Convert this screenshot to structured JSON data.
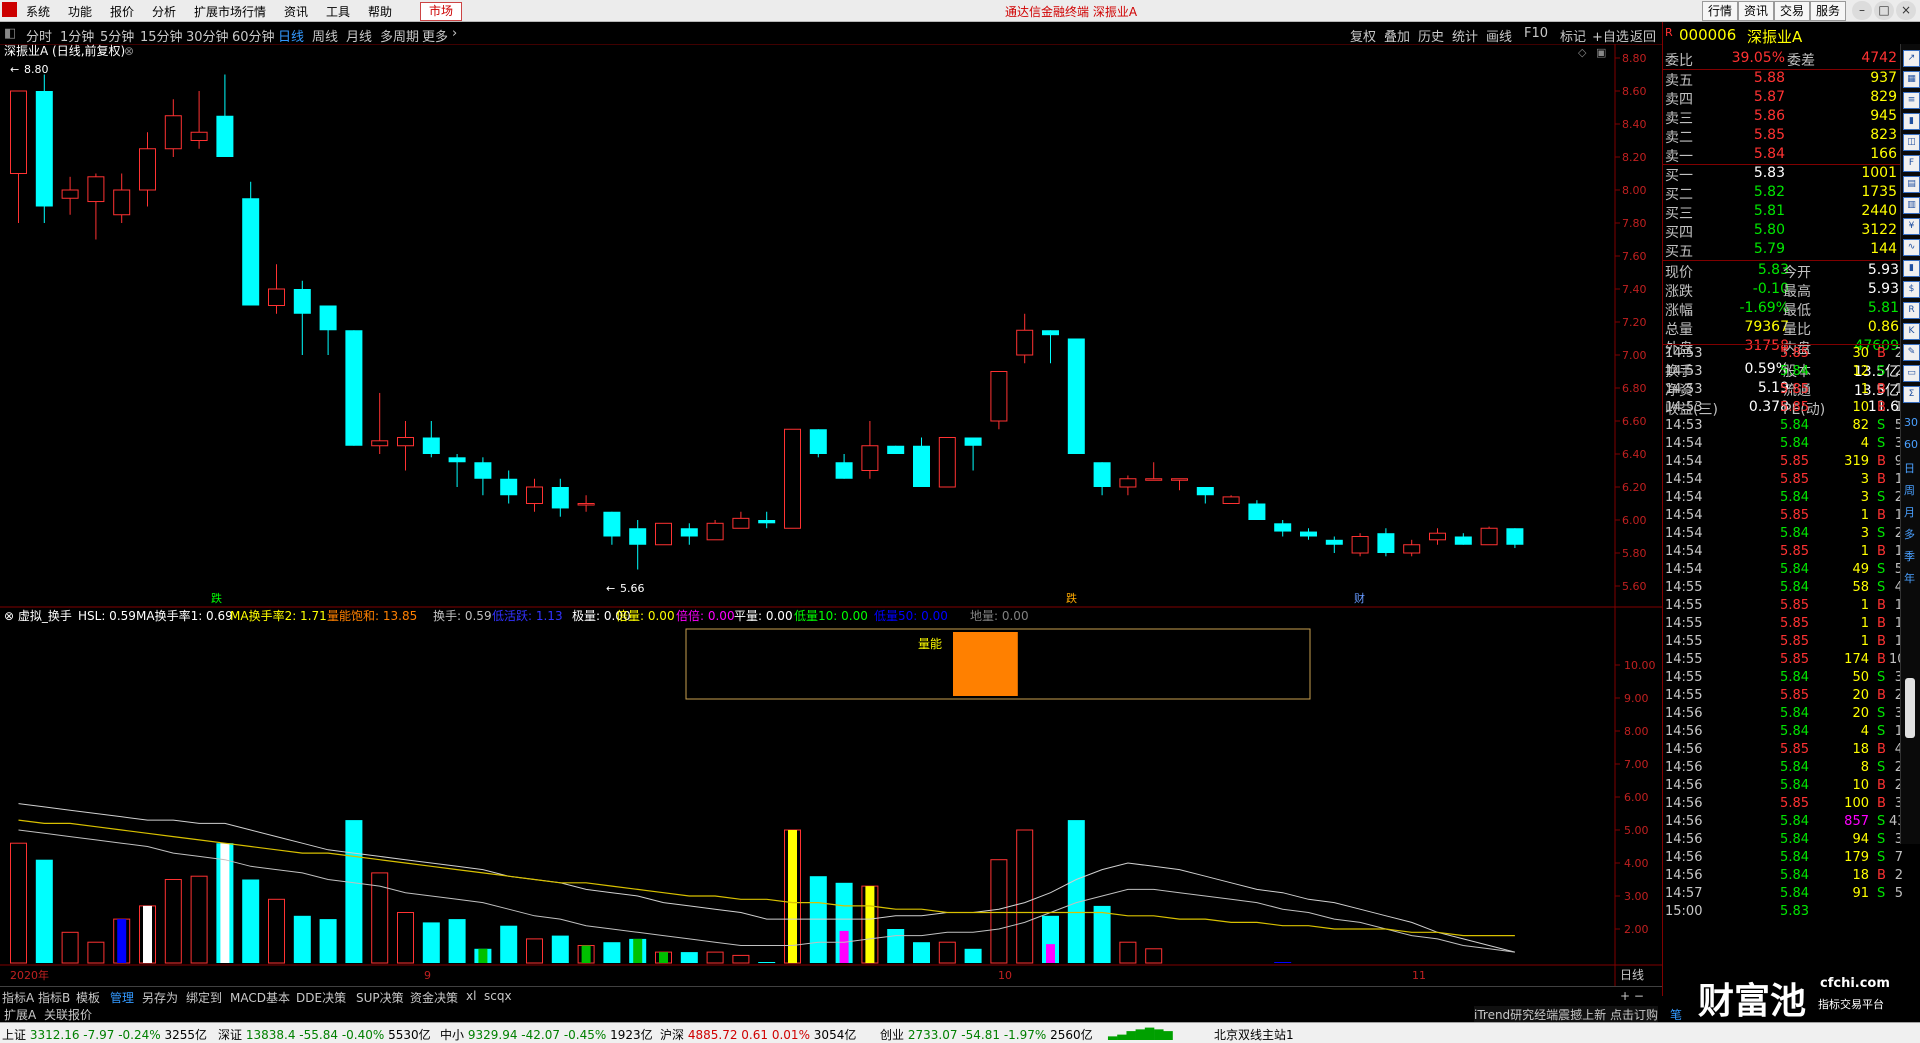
{
  "menu": {
    "items": [
      "系统",
      "功能",
      "报价",
      "分析",
      "扩展市场行情",
      "资讯",
      "工具",
      "帮助"
    ],
    "market_btn": "市场",
    "window_title": "通达信金融终端 深振业A",
    "right_buttons": [
      "行情",
      "资讯",
      "交易",
      "服务"
    ]
  },
  "periods": {
    "items": [
      "分时",
      "1分钟",
      "5分钟",
      "15分钟",
      "30分钟",
      "60分钟",
      "日线",
      "周线",
      "月线",
      "多周期",
      "更多"
    ],
    "active_index": 6,
    "tools": [
      "复权",
      "叠加",
      "历史",
      "统计",
      "画线",
      "F10",
      "标记",
      "+自选",
      "返回"
    ]
  },
  "stock": {
    "title": "深振业A (日线,前复权)",
    "code": "000006",
    "name": "深振业A",
    "high_label": "8.80",
    "low_label": "5.66",
    "markers": [
      "跌",
      "跌",
      "财"
    ]
  },
  "main_axis": {
    "ticks": [
      "8.80",
      "8.60",
      "8.40",
      "8.20",
      "8.00",
      "7.80",
      "7.60",
      "7.40",
      "7.20",
      "7.00",
      "6.80",
      "6.60",
      "6.40",
      "6.20",
      "6.00",
      "5.80",
      "5.60"
    ]
  },
  "indicator": {
    "name": "虚拟_换手",
    "items": [
      {
        "label": "HSL: 0.59",
        "color": "#ffffff"
      },
      {
        "label": "MA换手率1: 0.69",
        "color": "#ffffff"
      },
      {
        "label": "MA换手率2: 1.71",
        "color": "#ffff00"
      },
      {
        "label": "量能饱和: 13.85",
        "color": "#ff8000"
      },
      {
        "label": "换手: 0.59",
        "color": "#c0c0c0"
      },
      {
        "label": "低活跃: 1.13",
        "color": "#3232ff"
      },
      {
        "label": "极量: 0.00",
        "color": "#ffffff"
      },
      {
        "label": "倍量: 0.00",
        "color": "#ffff00"
      },
      {
        "label": "倍倍: 0.00",
        "color": "#ff00ff"
      },
      {
        "label": "平量: 0.00",
        "color": "#ffffff"
      },
      {
        "label": "低量10: 0.00",
        "color": "#00ff00"
      },
      {
        "label": "低量50: 0.00",
        "color": "#0000ff"
      },
      {
        "label": "地量: 0.00",
        "color": "#808080"
      }
    ],
    "box_label": "量能",
    "saturation_pct": 13.85,
    "axis_ticks": [
      "10.00",
      "9.00",
      "8.00",
      "7.00",
      "6.00",
      "5.00",
      "4.00",
      "3.00",
      "2.00"
    ],
    "date_labels": [
      "2020年",
      "9",
      "10",
      "11"
    ],
    "period_label": "日线"
  },
  "chart_data": {
    "type": "candlestick",
    "y_range": [
      5.6,
      8.8
    ],
    "candles": [
      [
        8.1,
        8.6,
        8.3,
        7.8
      ],
      [
        8.6,
        7.9,
        8.7,
        7.8
      ],
      [
        7.95,
        8.0,
        8.08,
        7.85
      ],
      [
        7.93,
        8.08,
        8.1,
        7.7
      ],
      [
        7.85,
        8.0,
        8.1,
        7.8
      ],
      [
        8.0,
        8.25,
        8.35,
        7.9
      ],
      [
        8.25,
        8.45,
        8.55,
        8.2
      ],
      [
        8.3,
        8.35,
        8.6,
        8.25
      ],
      [
        8.45,
        8.2,
        8.7,
        8.2
      ],
      [
        7.95,
        7.3,
        8.05,
        7.3
      ],
      [
        7.3,
        7.4,
        7.55,
        7.25
      ],
      [
        7.4,
        7.25,
        7.45,
        7.0
      ],
      [
        7.3,
        7.15,
        7.3,
        7.0
      ],
      [
        7.15,
        6.45,
        7.15,
        6.45
      ],
      [
        6.45,
        6.48,
        6.77,
        6.4
      ],
      [
        6.45,
        6.5,
        6.6,
        6.3
      ],
      [
        6.5,
        6.4,
        6.6,
        6.38
      ],
      [
        6.38,
        6.35,
        6.4,
        6.2
      ],
      [
        6.35,
        6.25,
        6.38,
        6.15
      ],
      [
        6.25,
        6.15,
        6.3,
        6.1
      ],
      [
        6.1,
        6.2,
        6.25,
        6.05
      ],
      [
        6.2,
        6.07,
        6.25,
        6.02
      ],
      [
        6.1,
        6.1,
        6.15,
        6.05
      ],
      [
        6.05,
        5.9,
        6.05,
        5.85
      ],
      [
        5.95,
        5.85,
        6.0,
        5.7
      ],
      [
        5.85,
        5.98,
        5.98,
        5.85
      ],
      [
        5.95,
        5.9,
        5.98,
        5.85
      ],
      [
        5.88,
        5.98,
        6.0,
        5.88
      ],
      [
        5.95,
        6.01,
        6.05,
        5.95
      ],
      [
        6.0,
        5.98,
        6.05,
        5.95
      ],
      [
        5.95,
        6.55,
        6.55,
        5.95
      ],
      [
        6.55,
        6.4,
        6.55,
        6.38
      ],
      [
        6.35,
        6.25,
        6.4,
        6.25
      ],
      [
        6.3,
        6.45,
        6.6,
        6.25
      ],
      [
        6.45,
        6.4,
        6.45,
        6.4
      ],
      [
        6.45,
        6.2,
        6.5,
        6.2
      ],
      [
        6.2,
        6.5,
        6.5,
        6.2
      ],
      [
        6.5,
        6.45,
        6.5,
        6.3
      ],
      [
        6.6,
        6.9,
        6.9,
        6.55
      ],
      [
        7.0,
        7.15,
        7.25,
        6.95
      ],
      [
        7.15,
        7.12,
        7.15,
        6.95
      ],
      [
        7.1,
        6.4,
        7.1,
        6.4
      ],
      [
        6.35,
        6.2,
        6.35,
        6.15
      ],
      [
        6.2,
        6.25,
        6.27,
        6.15
      ],
      [
        6.25,
        6.25,
        6.35,
        6.25
      ],
      [
        6.25,
        6.25,
        6.25,
        6.18
      ],
      [
        6.2,
        6.15,
        6.2,
        6.1
      ],
      [
        6.1,
        6.14,
        6.15,
        6.1
      ],
      [
        6.1,
        6.0,
        6.12,
        6.0
      ],
      [
        5.98,
        5.93,
        6.0,
        5.9
      ],
      [
        5.93,
        5.9,
        5.95,
        5.88
      ],
      [
        5.88,
        5.85,
        5.9,
        5.8
      ],
      [
        5.8,
        5.9,
        5.92,
        5.78
      ],
      [
        5.92,
        5.8,
        5.95,
        5.78
      ],
      [
        5.8,
        5.85,
        5.88,
        5.78
      ],
      [
        5.88,
        5.92,
        5.95,
        5.85
      ],
      [
        5.9,
        5.85,
        5.92,
        5.85
      ],
      [
        5.85,
        5.95,
        5.96,
        5.85
      ],
      [
        5.95,
        5.85,
        5.95,
        5.83
      ]
    ],
    "turnover": [
      4.6,
      4.1,
      1.9,
      1.6,
      2.3,
      2.7,
      3.5,
      3.6,
      4.6,
      3.5,
      2.9,
      2.4,
      2.3,
      5.3,
      3.7,
      2.5,
      2.2,
      2.3,
      1.4,
      2.1,
      1.7,
      1.8,
      1.5,
      1.6,
      1.7,
      1.3,
      1.3,
      1.3,
      1.2,
      1.0,
      5.0,
      3.6,
      3.4,
      3.3,
      2.0,
      1.6,
      1.6,
      1.4,
      4.1,
      5.0,
      2.4,
      5.3,
      2.7,
      1.6,
      1.4,
      0.9,
      0.8,
      0.8,
      0.9,
      1.0,
      0.9,
      0.8,
      0.8,
      0.9,
      0.8,
      0.7,
      0.6,
      0.9,
      0.6
    ],
    "ma1": [
      5.8,
      5.7,
      5.6,
      5.5,
      5.4,
      5.3,
      5.3,
      5.2,
      5.2,
      5.0,
      4.8,
      4.6,
      4.4,
      4.3,
      4.2,
      4.1,
      4.0,
      3.9,
      3.8,
      3.6,
      3.5,
      3.4,
      3.2,
      3.1,
      3.0,
      2.8,
      2.7,
      2.6,
      2.5,
      2.3,
      2.3,
      2.3,
      2.3,
      2.3,
      2.4,
      2.4,
      2.5,
      2.5,
      2.6,
      2.8,
      3.1,
      3.5,
      3.8,
      4.0,
      3.9,
      3.8,
      3.6,
      3.4,
      3.2,
      3.1,
      2.9,
      2.8,
      2.6,
      2.4,
      2.2,
      1.9,
      1.7,
      1.5,
      1.3
    ],
    "ma2": [
      5.0,
      4.9,
      4.8,
      4.7,
      4.6,
      4.5,
      4.3,
      4.2,
      4.1,
      3.9,
      3.8,
      3.7,
      3.5,
      3.4,
      3.3,
      3.1,
      3.0,
      2.9,
      2.8,
      2.6,
      2.4,
      2.3,
      2.1,
      2.0,
      1.9,
      1.8,
      1.7,
      1.6,
      1.5,
      1.5,
      1.5,
      1.6,
      1.6,
      1.7,
      1.8,
      1.8,
      1.9,
      1.9,
      2.0,
      2.2,
      2.5,
      2.8,
      3.0,
      3.2,
      3.2,
      3.1,
      3.0,
      2.9,
      2.8,
      2.6,
      2.5,
      2.3,
      2.2,
      2.0,
      1.8,
      1.7,
      1.5,
      1.4,
      1.3
    ],
    "ma3": [
      5.3,
      5.2,
      5.2,
      5.1,
      5.0,
      4.9,
      4.8,
      4.7,
      4.6,
      4.5,
      4.4,
      4.3,
      4.3,
      4.2,
      4.1,
      4.0,
      3.9,
      3.8,
      3.7,
      3.6,
      3.5,
      3.4,
      3.4,
      3.3,
      3.2,
      3.1,
      3.0,
      3.0,
      2.9,
      2.9,
      2.8,
      2.8,
      2.7,
      2.7,
      2.6,
      2.6,
      2.5,
      2.5,
      2.5,
      2.5,
      2.5,
      2.5,
      2.5,
      2.4,
      2.4,
      2.3,
      2.3,
      2.2,
      2.2,
      2.1,
      2.1,
      2.0,
      2.0,
      2.0,
      1.9,
      1.9,
      1.8,
      1.8,
      1.8
    ]
  },
  "quote": {
    "weibi_label": "委比",
    "weibi": "39.05%",
    "weicha_label": "委差",
    "weicha": "4742",
    "asks": [
      {
        "label": "卖五",
        "price": "5.88",
        "vol": "937"
      },
      {
        "label": "卖四",
        "price": "5.87",
        "vol": "829"
      },
      {
        "label": "卖三",
        "price": "5.86",
        "vol": "945"
      },
      {
        "label": "卖二",
        "price": "5.85",
        "vol": "823"
      },
      {
        "label": "卖一",
        "price": "5.84",
        "vol": "166"
      }
    ],
    "bids": [
      {
        "label": "买一",
        "price": "5.83",
        "vol": "1001"
      },
      {
        "label": "买二",
        "price": "5.82",
        "vol": "1735"
      },
      {
        "label": "买三",
        "price": "5.81",
        "vol": "2440"
      },
      {
        "label": "买四",
        "price": "5.80",
        "vol": "3122"
      },
      {
        "label": "买五",
        "price": "5.79",
        "vol": "144"
      }
    ],
    "fields": [
      {
        "l1": "现价",
        "v1": "5.83",
        "c1": "grn",
        "l2": "今开",
        "v2": "5.93",
        "c2": "wht"
      },
      {
        "l1": "涨跌",
        "v1": "-0.10",
        "c1": "grn",
        "l2": "最高",
        "v2": "5.93",
        "c2": "wht"
      },
      {
        "l1": "涨幅",
        "v1": "-1.69%",
        "c1": "grn",
        "l2": "最低",
        "v2": "5.81",
        "c2": "grn"
      },
      {
        "l1": "总量",
        "v1": "79367",
        "c1": "yel",
        "l2": "量比",
        "v2": "0.86",
        "c2": "yel"
      },
      {
        "l1": "外盘",
        "v1": "31758",
        "c1": "red",
        "l2": "内盘",
        "v2": "47609",
        "c2": "grn"
      },
      {
        "l1": "换手",
        "v1": "0.59%",
        "c1": "wht",
        "l2": "股本",
        "v2": "13.5亿",
        "c2": "wht"
      },
      {
        "l1": "净资",
        "v1": "5.19",
        "c1": "wht",
        "l2": "流通",
        "v2": "13.5亿",
        "c2": "wht"
      },
      {
        "l1": "收益(三)",
        "v1": "0.378",
        "c1": "wht",
        "l2": "PE(动)",
        "v2": "11.6",
        "c2": "wht"
      }
    ]
  },
  "ticks": [
    {
      "t": "14:53",
      "p": "5.85",
      "v": "30",
      "s": "B",
      "n": "2"
    },
    {
      "t": "14:53",
      "p": "5.84",
      "v": "12",
      "s": "S",
      "n": "2"
    },
    {
      "t": "14:53",
      "p": "5.85",
      "v": "1",
      "s": "B",
      "n": "1"
    },
    {
      "t": "14:53",
      "p": "5.85",
      "v": "10",
      "s": "B",
      "n": "1"
    },
    {
      "t": "14:53",
      "p": "5.84",
      "v": "82",
      "s": "S",
      "n": "5"
    },
    {
      "t": "14:54",
      "p": "5.84",
      "v": "4",
      "s": "S",
      "n": "3"
    },
    {
      "t": "14:54",
      "p": "5.85",
      "v": "319",
      "s": "B",
      "n": "9"
    },
    {
      "t": "14:54",
      "p": "5.85",
      "v": "3",
      "s": "B",
      "n": "1"
    },
    {
      "t": "14:54",
      "p": "5.84",
      "v": "3",
      "s": "S",
      "n": "2"
    },
    {
      "t": "14:54",
      "p": "5.85",
      "v": "1",
      "s": "B",
      "n": "1"
    },
    {
      "t": "14:54",
      "p": "5.84",
      "v": "3",
      "s": "S",
      "n": "2"
    },
    {
      "t": "14:54",
      "p": "5.85",
      "v": "1",
      "s": "B",
      "n": "1"
    },
    {
      "t": "14:54",
      "p": "5.84",
      "v": "49",
      "s": "S",
      "n": "5"
    },
    {
      "t": "14:55",
      "p": "5.84",
      "v": "58",
      "s": "S",
      "n": "4"
    },
    {
      "t": "14:55",
      "p": "5.85",
      "v": "1",
      "s": "B",
      "n": "1"
    },
    {
      "t": "14:55",
      "p": "5.85",
      "v": "1",
      "s": "B",
      "n": "1"
    },
    {
      "t": "14:55",
      "p": "5.85",
      "v": "1",
      "s": "B",
      "n": "1"
    },
    {
      "t": "14:55",
      "p": "5.85",
      "v": "174",
      "s": "B",
      "n": "10"
    },
    {
      "t": "14:55",
      "p": "5.84",
      "v": "50",
      "s": "S",
      "n": "3"
    },
    {
      "t": "14:55",
      "p": "5.85",
      "v": "20",
      "s": "B",
      "n": "2"
    },
    {
      "t": "14:56",
      "p": "5.84",
      "v": "20",
      "s": "S",
      "n": "3"
    },
    {
      "t": "14:56",
      "p": "5.84",
      "v": "4",
      "s": "S",
      "n": "1"
    },
    {
      "t": "14:56",
      "p": "5.85",
      "v": "18",
      "s": "B",
      "n": "4"
    },
    {
      "t": "14:56",
      "p": "5.84",
      "v": "8",
      "s": "S",
      "n": "2"
    },
    {
      "t": "14:56",
      "p": "5.84",
      "v": "10",
      "s": "B",
      "n": "2"
    },
    {
      "t": "14:56",
      "p": "5.85",
      "v": "100",
      "s": "B",
      "n": "3"
    },
    {
      "t": "14:56",
      "p": "5.84",
      "v": "857",
      "s": "S",
      "n": "43"
    },
    {
      "t": "14:56",
      "p": "5.84",
      "v": "94",
      "s": "S",
      "n": "3"
    },
    {
      "t": "14:56",
      "p": "5.84",
      "v": "179",
      "s": "S",
      "n": "7"
    },
    {
      "t": "14:56",
      "p": "5.84",
      "v": "18",
      "s": "B",
      "n": "2"
    },
    {
      "t": "14:57",
      "p": "5.84",
      "v": "91",
      "s": "S",
      "n": "5"
    },
    {
      "t": "15:00",
      "p": "5.83",
      "v": "",
      "s": "",
      "n": ""
    }
  ],
  "sidebar_icons": [
    "30",
    "60",
    "日",
    "周",
    "月",
    "多",
    "季",
    "年"
  ],
  "bottom_tabs": [
    "指标A",
    "指标B",
    "模板",
    "管理",
    "另存为",
    "绑定到",
    "MACD基本",
    "DDE决策",
    "SUP决策",
    "资金决策",
    "xl",
    "scqx"
  ],
  "bottom_tabs_active": 3,
  "bar2": {
    "left": [
      "扩展A",
      "关联报价"
    ],
    "news": "iTrend研究经端震撼上新 点击订购",
    "tab": "笔"
  },
  "status": {
    "items": [
      {
        "label": "上证",
        "val": "3312.16",
        "chg": "-7.97",
        "pct": "-0.24%",
        "amt": "3255亿"
      },
      {
        "label": "深证",
        "val": "13838.4",
        "chg": "-55.84",
        "pct": "-0.40%",
        "amt": "5530亿"
      },
      {
        "label": "中小",
        "val": "9329.94",
        "chg": "-42.07",
        "pct": "-0.45%",
        "amt": "1923亿"
      },
      {
        "label": "沪深",
        "val": "4885.72",
        "chg": "0.61",
        "pct": "0.01%",
        "amt": "3054亿"
      },
      {
        "label": "创业",
        "val": "2733.07",
        "chg": "-54.81",
        "pct": "-1.97%",
        "amt": "2560亿"
      }
    ],
    "server": "北京双线主站1"
  },
  "watermark": {
    "text": "财富池",
    "site": "cfchi.com",
    "sub": "指标交易平台"
  }
}
